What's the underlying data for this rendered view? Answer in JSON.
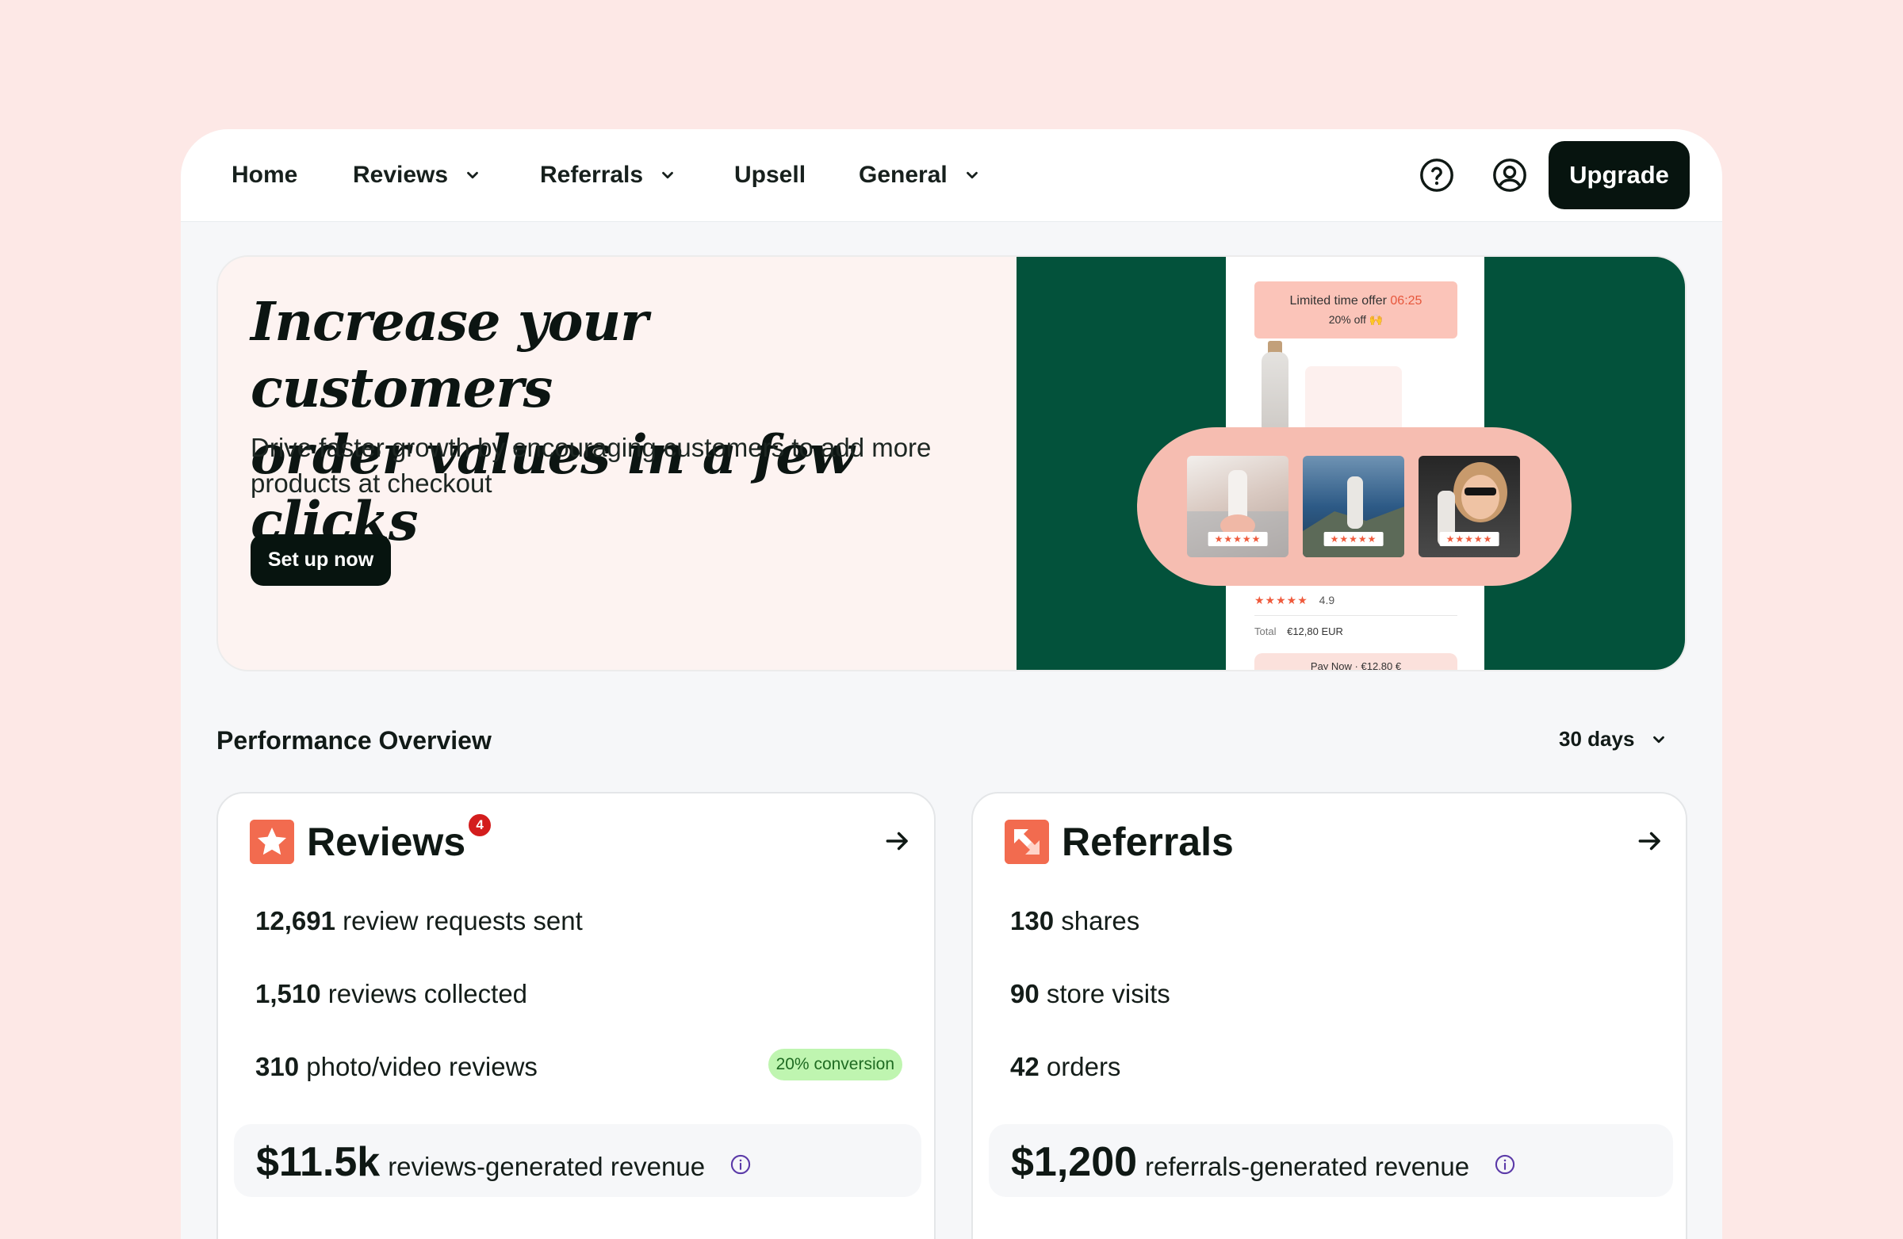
{
  "nav": {
    "items": [
      {
        "label": "Home",
        "dropdown": false
      },
      {
        "label": "Reviews",
        "dropdown": true
      },
      {
        "label": "Referrals",
        "dropdown": true
      },
      {
        "label": "Upsell",
        "dropdown": false
      },
      {
        "label": "General",
        "dropdown": true
      }
    ],
    "help_icon": "help-circle-icon",
    "account_icon": "user-circle-icon",
    "upgrade_label": "Upgrade"
  },
  "hero": {
    "title_line1": "Increase your customers",
    "title_line2": "order values in a few clicks",
    "subtitle": "Drive faster growth by encouraging customers to add more products at checkout",
    "cta_label": "Set up now",
    "preview": {
      "offer_text": "Limited time offer",
      "offer_timer": "06:25",
      "offer_discount": "20% off 🙌",
      "thumb_stars": [
        "★★★★★",
        "★★★★★",
        "★★★★★"
      ],
      "rating_stars": "★★★★★",
      "rating_value": "4.9",
      "total_label": "Total",
      "total_value": "€12,80 EUR",
      "pay_now": "Pay Now · €12,80 €"
    }
  },
  "performance": {
    "title": "Performance Overview",
    "range": "30 days"
  },
  "reviews_card": {
    "title": "Reviews",
    "badge": "4",
    "metrics": [
      {
        "value": "12,691",
        "label": "review requests sent"
      },
      {
        "value": "1,510",
        "label": "reviews collected"
      },
      {
        "value": "310",
        "label": "photo/video reviews"
      }
    ],
    "conversion_badge": "20% conversion",
    "revenue_value": "$11.5k",
    "revenue_label": "reviews-generated revenue"
  },
  "referrals_card": {
    "title": "Referrals",
    "metrics": [
      {
        "value": "130",
        "label": "shares"
      },
      {
        "value": "90",
        "label": "store visits"
      },
      {
        "value": "42",
        "label": "orders"
      }
    ],
    "revenue_value": "$1,200",
    "revenue_label": "referrals-generated revenue"
  },
  "colors": {
    "background": "#fde8e6",
    "accent_dark": "#07140f",
    "hero_green": "#03523b",
    "brand_coral": "#f26b4f",
    "badge_red": "#d31d1d",
    "conversion_green": "#bff5b0"
  }
}
